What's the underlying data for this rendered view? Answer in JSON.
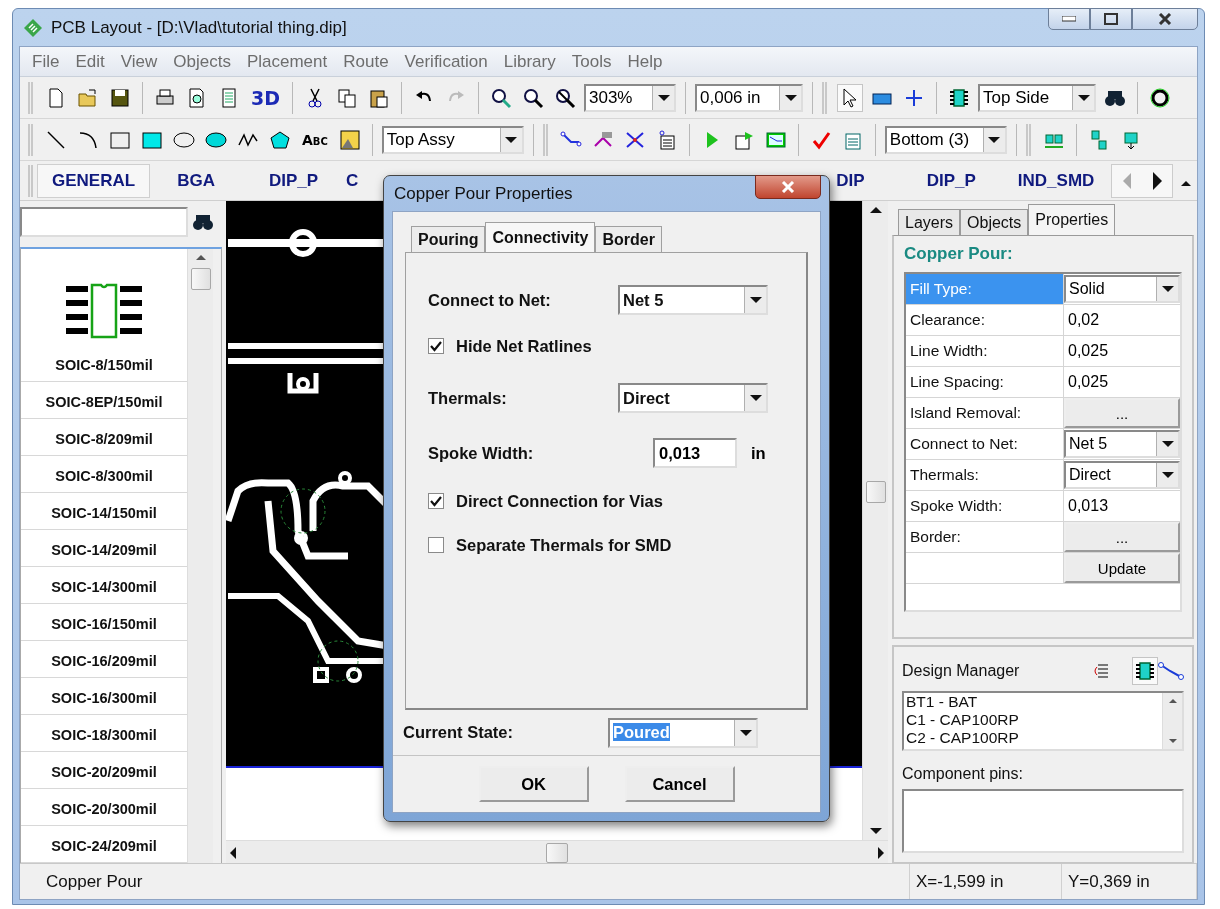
{
  "window": {
    "title": "PCB Layout - [D:\\Vlad\\tutorial thing.dip]"
  },
  "menu": [
    "File",
    "Edit",
    "View",
    "Objects",
    "Placement",
    "Route",
    "Verification",
    "Library",
    "Tools",
    "Help"
  ],
  "toolbar": {
    "view_3d": "3D",
    "zoom": "303%",
    "grid": "0,006 in",
    "side": "Top Side",
    "text_tool": "Abc",
    "layer": "Top Assy",
    "bottom_layer": "Bottom (3)"
  },
  "library_tabs": [
    {
      "label": "GENERAL",
      "selected": true
    },
    {
      "label": "BGA",
      "selected": false
    },
    {
      "label": "DIP_P",
      "selected": false
    },
    {
      "label": "C",
      "selected": false
    },
    {
      "label": "DIP",
      "selected": false
    },
    {
      "label": "DIP_P",
      "selected": false
    },
    {
      "label": "IND_SMD",
      "selected": false
    }
  ],
  "library": {
    "items": [
      "SOIC-8/150mil",
      "SOIC-8EP/150mil",
      "SOIC-8/209mil",
      "SOIC-8/300mil",
      "SOIC-14/150mil",
      "SOIC-14/209mil",
      "SOIC-14/300mil",
      "SOIC-16/150mil",
      "SOIC-16/209mil",
      "SOIC-16/300mil",
      "SOIC-18/300mil",
      "SOIC-20/209mil",
      "SOIC-20/300mil",
      "SOIC-24/209mil"
    ]
  },
  "panel_tabs": [
    {
      "label": "Layers",
      "selected": false
    },
    {
      "label": "Objects",
      "selected": false
    },
    {
      "label": "Properties",
      "selected": true
    }
  ],
  "properties": {
    "heading": "Copper Pour:",
    "rows": [
      {
        "label": "Fill Type:",
        "value": "Solid",
        "kind": "dropdown",
        "selected": true
      },
      {
        "label": "Clearance:",
        "value": "0,02",
        "kind": "text",
        "selected": false
      },
      {
        "label": "Line Width:",
        "value": "0,025",
        "kind": "text",
        "selected": false
      },
      {
        "label": "Line Spacing:",
        "value": "0,025",
        "kind": "text",
        "selected": false
      },
      {
        "label": "Island Removal:",
        "value": "...",
        "kind": "button",
        "selected": false
      },
      {
        "label": "Connect to Net:",
        "value": "Net 5",
        "kind": "dropdown",
        "selected": false
      },
      {
        "label": "Thermals:",
        "value": "Direct",
        "kind": "dropdown",
        "selected": false
      },
      {
        "label": "Spoke Width:",
        "value": "0,013",
        "kind": "text",
        "selected": false
      },
      {
        "label": "Border:",
        "value": "...",
        "kind": "button",
        "selected": false
      },
      {
        "value": "Update",
        "kind": "button",
        "selected": false
      }
    ]
  },
  "design_manager": {
    "title": "Design Manager",
    "items": [
      "BT1 - BAT",
      "C1 - CAP100RP",
      "C2 - CAP100RP"
    ],
    "pins_label": "Component pins:"
  },
  "dialog": {
    "title": "Copper Pour Properties",
    "tabs": [
      {
        "label": "Pouring",
        "selected": false
      },
      {
        "label": "Connectivity",
        "selected": true
      },
      {
        "label": "Border",
        "selected": false
      }
    ],
    "fields": [
      {
        "kind": "dropdown",
        "label": "Connect to Net:",
        "value": "Net 5"
      },
      {
        "kind": "checkbox",
        "label": "Hide Net Ratlines",
        "checked": true
      },
      {
        "kind": "dropdown",
        "label": "Thermals:",
        "value": "Direct"
      },
      {
        "kind": "input",
        "label": "Spoke Width:",
        "value": "0,013",
        "unit": "in"
      },
      {
        "kind": "checkbox",
        "label": "Direct Connection for Vias",
        "checked": true
      },
      {
        "kind": "checkbox",
        "label": "Separate Thermals for SMD",
        "checked": false
      }
    ],
    "current_state": {
      "label": "Current State:",
      "value": "Poured"
    },
    "buttons": [
      "OK",
      "Cancel"
    ]
  },
  "status_bar": {
    "message": "Copper Pour",
    "x": "X=-1,599 in",
    "y": "Y=0,369 in"
  }
}
